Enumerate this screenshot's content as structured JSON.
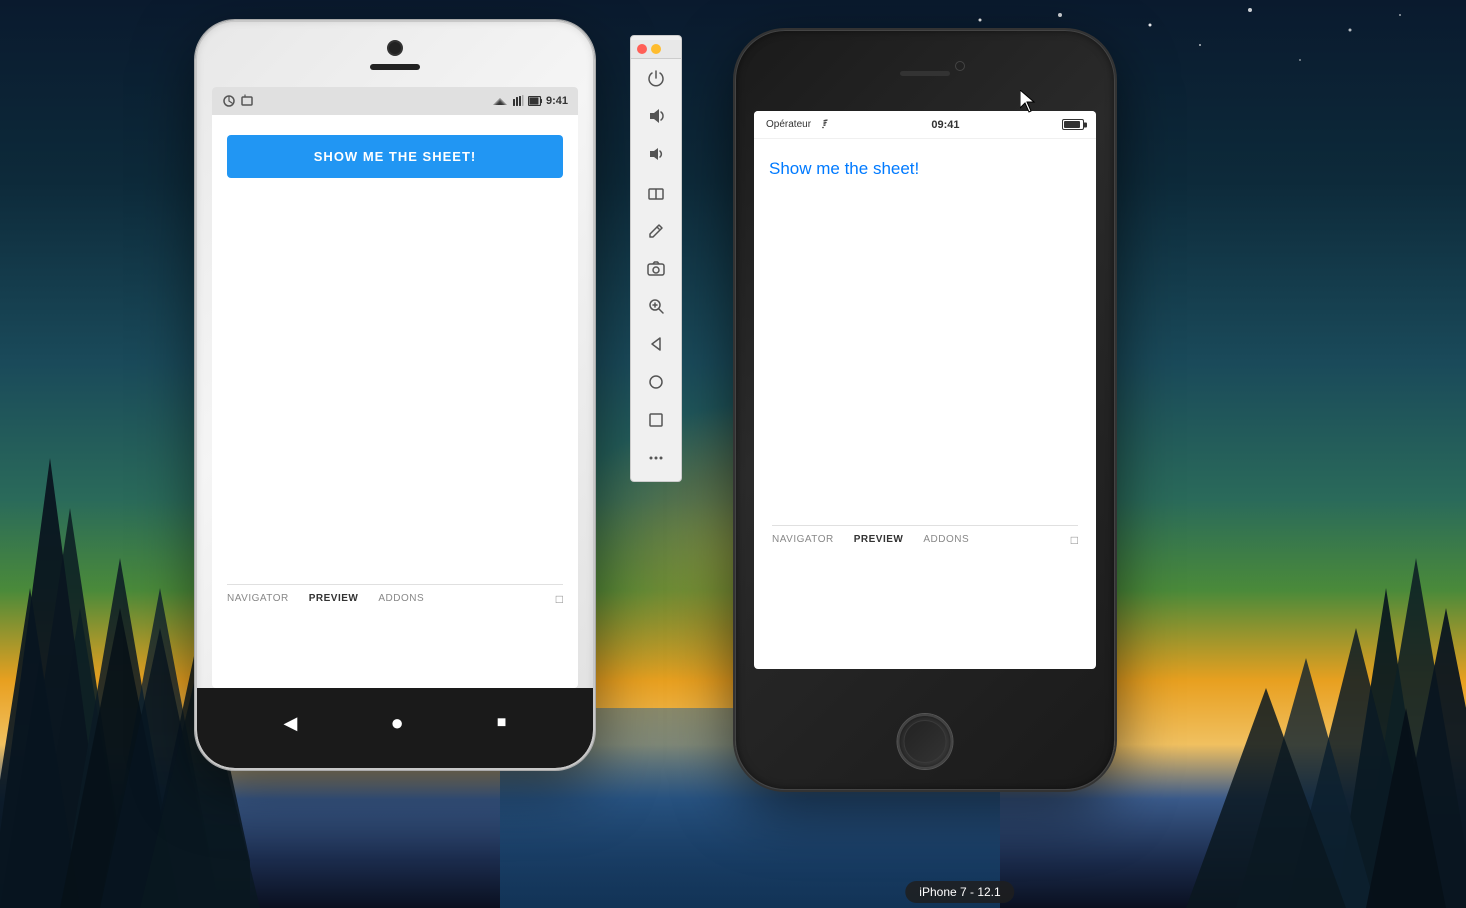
{
  "background": {
    "gradient_desc": "night forest background with teal/blue sky and warm sunset glow"
  },
  "toolbar": {
    "close_label": "×",
    "minimize_label": "−",
    "icons": [
      {
        "name": "power-icon",
        "symbol": "⏻"
      },
      {
        "name": "volume-up-icon",
        "symbol": "🔊"
      },
      {
        "name": "volume-down-icon",
        "symbol": "🔉"
      },
      {
        "name": "eraser-icon",
        "symbol": "◇"
      },
      {
        "name": "pen-icon",
        "symbol": "◈"
      },
      {
        "name": "camera-icon",
        "symbol": "📷"
      },
      {
        "name": "zoom-icon",
        "symbol": "🔍"
      },
      {
        "name": "back-icon",
        "symbol": "◁"
      },
      {
        "name": "circle-icon",
        "symbol": "○"
      },
      {
        "name": "square-icon",
        "symbol": "□"
      },
      {
        "name": "more-icon",
        "symbol": "•••"
      }
    ]
  },
  "android_device": {
    "status_bar": {
      "time": "9:41",
      "icons": "🔋"
    },
    "button_label": "SHOW ME THE SHEET!",
    "tabs": [
      {
        "label": "NAVIGATOR",
        "active": false
      },
      {
        "label": "PREVIEW",
        "active": true
      },
      {
        "label": "ADDONS",
        "active": false
      }
    ],
    "nav_icons": [
      "◀",
      "●",
      "■"
    ]
  },
  "iphone_device": {
    "label": "iPhone 7 - 12.1",
    "status_bar": {
      "carrier": "Opérateur",
      "wifi": "wifi",
      "time": "09:41",
      "battery": "battery"
    },
    "content_text": "Show me the sheet!",
    "tabs": [
      {
        "label": "NAVIGATOR",
        "active": false
      },
      {
        "label": "PREVIEW",
        "active": true
      },
      {
        "label": "ADDONS",
        "active": false
      }
    ]
  }
}
